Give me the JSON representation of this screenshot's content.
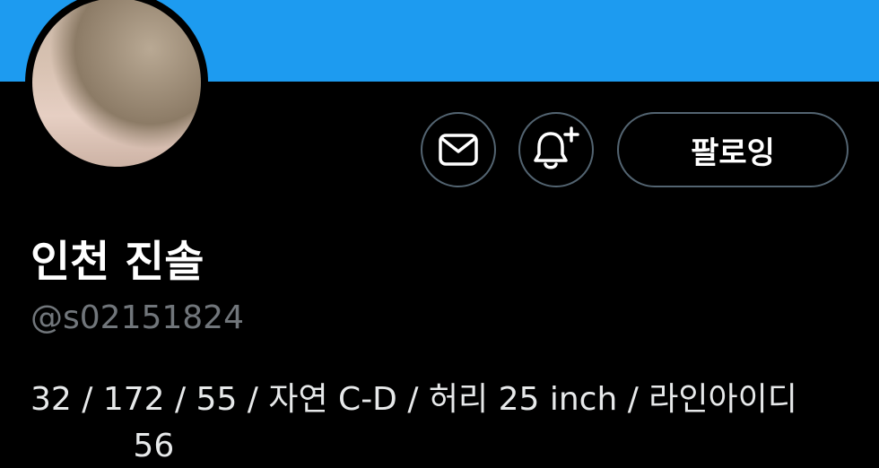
{
  "banner": {
    "color": "#1d9bf0"
  },
  "profile": {
    "display_name": "인천 진솔",
    "handle": "@s02151824",
    "bio_line1": "32 / 172 / 55 / 자연 C-D / 허리 25 inch / 라인아이디",
    "bio_line2": "          56"
  },
  "actions": {
    "message_icon": "envelope-icon",
    "notify_icon": "bell-plus-icon",
    "follow_label": "팔로잉"
  }
}
